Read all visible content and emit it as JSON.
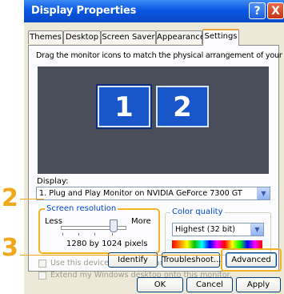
{
  "window": {
    "title": "Display Properties",
    "help": "?",
    "close": "X"
  },
  "tabs": [
    "Themes",
    "Desktop",
    "Screen Saver",
    "Appearance",
    "Settings"
  ],
  "instruction": "Drag the monitor icons to match the physical arrangement of your monitors.",
  "monitors": [
    "1",
    "2"
  ],
  "display": {
    "label": "Display:",
    "value": "1. Plug and Play Monitor on NVIDIA GeForce 7300 GT"
  },
  "screen_resolution": {
    "title": "Screen resolution",
    "less": "Less",
    "more": "More",
    "value": "1280 by 1024 pixels"
  },
  "color_quality": {
    "title": "Color quality",
    "value": "Highest (32 bit)"
  },
  "options": {
    "primary": "Use this device as the primary monitor.",
    "extend": "Extend my Windows desktop onto this monitor."
  },
  "buttons": {
    "identify": "Identify",
    "troubleshoot": "Troubleshoot...",
    "advanced": "Advanced",
    "ok": "OK",
    "cancel": "Cancel",
    "apply": "Apply"
  },
  "callouts": [
    "2",
    "3"
  ],
  "colors": {
    "accent": "#f0a81a",
    "titlebar": "#0a58e2",
    "monitor": "#1856c9"
  }
}
